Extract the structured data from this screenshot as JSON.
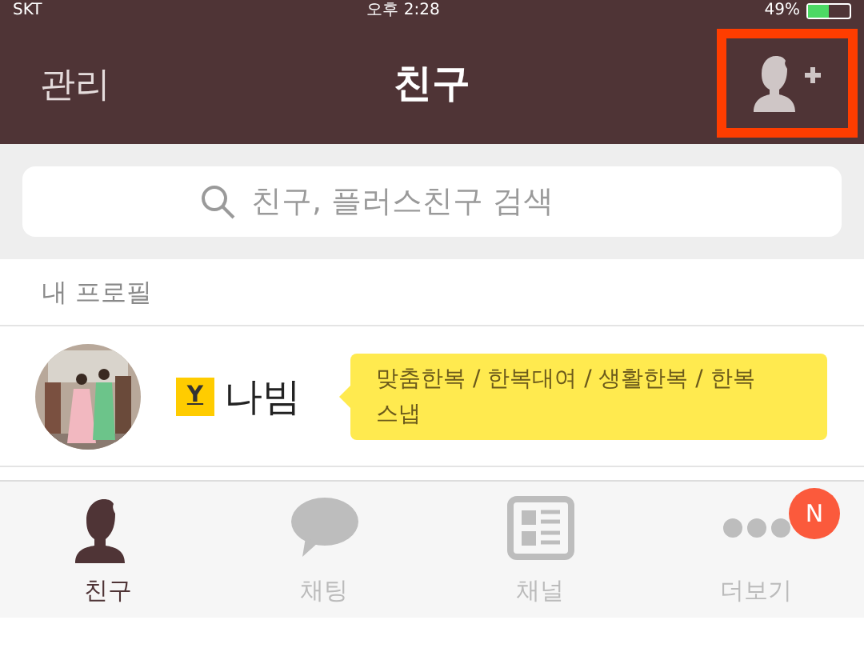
{
  "status_bar": {
    "carrier": "SKT",
    "time": "오후 2:28",
    "battery": "49%"
  },
  "nav": {
    "left": "관리",
    "title": "친구",
    "add_highlighted": true
  },
  "search": {
    "placeholder": "친구, 플러스친구 검색"
  },
  "section": {
    "title": "내 프로필"
  },
  "profile": {
    "badge": "Y",
    "name": "나빔",
    "status": "맞춤한복 / 한복대여 / 생활한복 / 한복 스냅"
  },
  "tabs": [
    {
      "label": "친구",
      "kind": "friends",
      "selected": true
    },
    {
      "label": "채팅",
      "kind": "chat",
      "selected": false
    },
    {
      "label": "채널",
      "kind": "channel",
      "selected": false
    },
    {
      "label": "더보기",
      "kind": "more",
      "selected": false,
      "badge": "N"
    }
  ]
}
